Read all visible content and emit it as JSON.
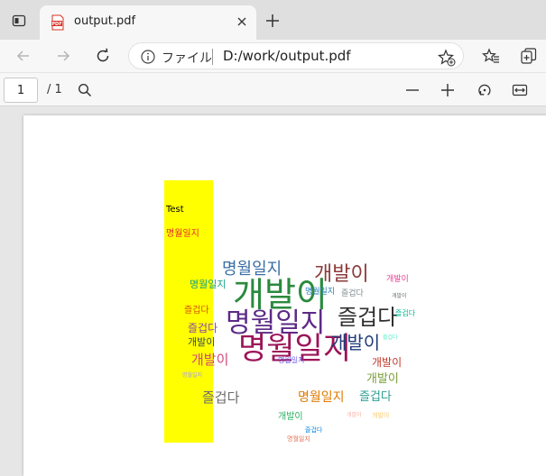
{
  "tab": {
    "title": "output.pdf",
    "favicon_label": "PDF"
  },
  "address": {
    "label": "ファイル",
    "url": "D:/work/output.pdf"
  },
  "pdf_toolbar": {
    "page_current": "1",
    "page_total": "/ 1"
  },
  "document": {
    "label_test": "Test",
    "label_korean": "명월일지",
    "wordcloud_words": [
      {
        "t": "개발이",
        "c": "#2b8a3e",
        "s": 38
      },
      {
        "t": "명월일지",
        "c": "#5b2a86",
        "s": 30
      },
      {
        "t": "명월일지",
        "c": "#9c1458",
        "s": 34
      },
      {
        "t": "개발이",
        "c": "#8b3a3a",
        "s": 22
      },
      {
        "t": "명월일지",
        "c": "#3a6ea5",
        "s": 18
      },
      {
        "t": "즐겁다",
        "c": "#2f2f2f",
        "s": 24
      },
      {
        "t": "개발이",
        "c": "#1f3d7a",
        "s": 20
      },
      {
        "t": "개발이",
        "c": "#d4477a",
        "s": 15
      },
      {
        "t": "즐겁다",
        "c": "#6c6c6c",
        "s": 15
      },
      {
        "t": "명월일지",
        "c": "#e07b00",
        "s": 14
      },
      {
        "t": "즐겁다",
        "c": "#2a9d8f",
        "s": 13
      },
      {
        "t": "개발이",
        "c": "#7a9e3a",
        "s": 13
      },
      {
        "t": "즐겁다",
        "c": "#8e44ad",
        "s": 12
      },
      {
        "t": "개발이",
        "c": "#c0392b",
        "s": 12
      },
      {
        "t": "명월일지",
        "c": "#16a085",
        "s": 11
      },
      {
        "t": "개발이",
        "c": "#34495e",
        "s": 11
      },
      {
        "t": "즐겁다",
        "c": "#d35400",
        "s": 10
      },
      {
        "t": "개발이",
        "c": "#27ae60",
        "s": 10
      },
      {
        "t": "명월일지",
        "c": "#2980b9",
        "s": 9
      },
      {
        "t": "즐겁다",
        "c": "#7f8c8d",
        "s": 9
      },
      {
        "t": "개발이",
        "c": "#e84393",
        "s": 9
      },
      {
        "t": "명월일지",
        "c": "#6c5ce7",
        "s": 8
      },
      {
        "t": "즐겁다",
        "c": "#00b894",
        "s": 8
      },
      {
        "t": "개발이",
        "c": "#fdcb6e",
        "s": 7
      },
      {
        "t": "명월일지",
        "c": "#e17055",
        "s": 7
      },
      {
        "t": "즐겁다",
        "c": "#0984e3",
        "s": 7
      },
      {
        "t": "개발이",
        "c": "#636e72",
        "s": 6
      },
      {
        "t": "명월일지",
        "c": "#a29bfe",
        "s": 6
      },
      {
        "t": "즐겁다",
        "c": "#55efc4",
        "s": 6
      },
      {
        "t": "개발이",
        "c": "#fab1a0",
        "s": 6
      }
    ]
  }
}
